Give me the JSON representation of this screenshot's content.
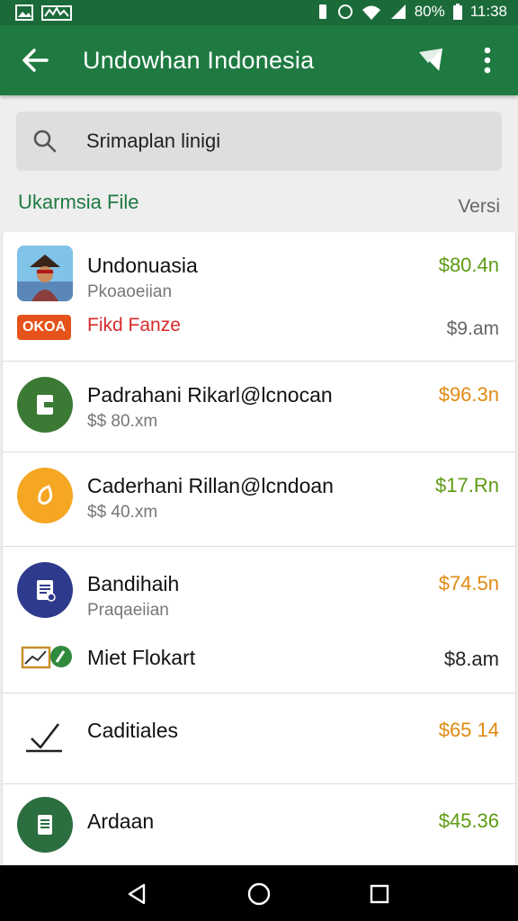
{
  "status_bar": {
    "battery": "80%",
    "time": "11:38"
  },
  "app_bar": {
    "title": "Undowhan Indonesia"
  },
  "search": {
    "text": "Srimaplan linigi"
  },
  "section": {
    "title": "Ukarmsia File",
    "right_label": "Versi"
  },
  "rows": [
    {
      "name": "Undonuasia",
      "sub": "Pkoaoeiian",
      "amount": "$80.4n",
      "amount_color": "green",
      "extra": {
        "badge": "OKOA",
        "label": "Fikd Fanze",
        "amount": "$9.am"
      }
    },
    {
      "name": "Padrahani Rikarl@lcnocan",
      "sub": "$$ 80.xm",
      "amount": "$96.3n",
      "amount_color": "orange"
    },
    {
      "name": "Caderhani Rillan@lcndoan",
      "sub": "$$ 40.xm",
      "amount": "$17.Rn",
      "amount_color": "green"
    },
    {
      "name": "Bandihaih",
      "sub": "Praqaeiian",
      "amount": "$74.5n",
      "amount_color": "orange",
      "extra": {
        "label": "Miet Flokart",
        "amount": "$8.am"
      }
    },
    {
      "name": "Caditiales",
      "amount": "$65 14",
      "amount_color": "orange"
    },
    {
      "name": "Ardaan",
      "amount": "$45.36",
      "amount_color": "green"
    }
  ],
  "colors": {
    "primary": "#1f7a42",
    "status_bar": "#1b6b3a",
    "green_amount": "#5d9b13",
    "orange_amount": "#e08a12"
  }
}
